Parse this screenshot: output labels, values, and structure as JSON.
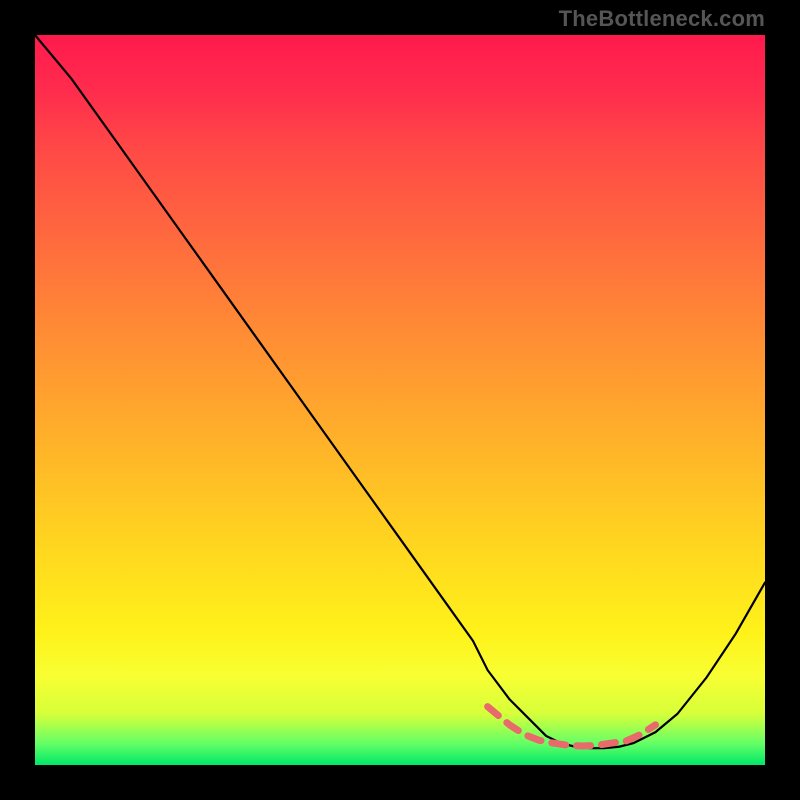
{
  "watermark": "TheBottleneck.com",
  "chart_data": {
    "type": "line",
    "title": "",
    "xlabel": "",
    "ylabel": "",
    "ylim": [
      0,
      100
    ],
    "xlim": [
      0,
      100
    ],
    "series": [
      {
        "name": "bottleneck-curve",
        "x": [
          0,
          5,
          10,
          15,
          20,
          25,
          30,
          35,
          40,
          45,
          50,
          55,
          60,
          62,
          65,
          68,
          70,
          72,
          74,
          76,
          78,
          80,
          82,
          85,
          88,
          92,
          96,
          100
        ],
        "y": [
          100,
          94,
          87,
          80,
          73,
          66,
          59,
          52,
          45,
          38,
          31,
          24,
          17,
          13,
          9,
          6,
          4,
          3,
          2.5,
          2.3,
          2.3,
          2.5,
          3,
          4.5,
          7,
          12,
          18,
          25
        ]
      }
    ],
    "dashed_segment": {
      "name": "bottleneck-optimal-region",
      "x": [
        62,
        65,
        67,
        69,
        71,
        73,
        75,
        77,
        79,
        81,
        83,
        85
      ],
      "y": [
        8,
        5.5,
        4.2,
        3.4,
        3,
        2.7,
        2.6,
        2.7,
        3,
        3.3,
        4.2,
        5.5
      ]
    },
    "background_gradient": {
      "top": "#ff1a4d",
      "middle": "#ffd61f",
      "bottom": "#00e868"
    },
    "colors": {
      "curve": "#000000",
      "dash": "#e86a6a",
      "frame": "#000000"
    }
  }
}
